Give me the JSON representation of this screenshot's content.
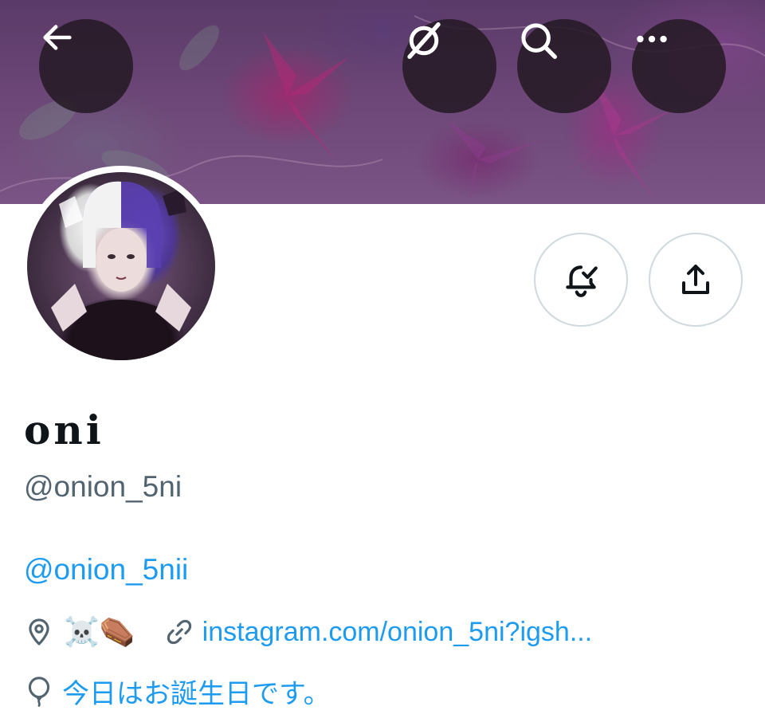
{
  "header": {
    "back_icon": "arrow-left-icon",
    "grok_icon": "slashed-circle-icon",
    "search_icon": "search-icon",
    "more_icon": "more-dots-icon"
  },
  "profile": {
    "display_name": "oni",
    "handle": "@onion_5ni",
    "bio_mention": "@onion_5nii",
    "location_emoji": "☠️⚰️",
    "website": "instagram.com/onion_5ni?igsh...",
    "birthday_text": "今日はお誕生日です。"
  },
  "actions": {
    "notifications_icon": "bell-check-icon",
    "share_icon": "share-upload-icon"
  },
  "colors": {
    "link": "#1d9bf0",
    "secondary_text": "#536471",
    "primary_text": "#0f1419",
    "button_border": "#cfd9de",
    "overlay_button": "#261a26"
  }
}
